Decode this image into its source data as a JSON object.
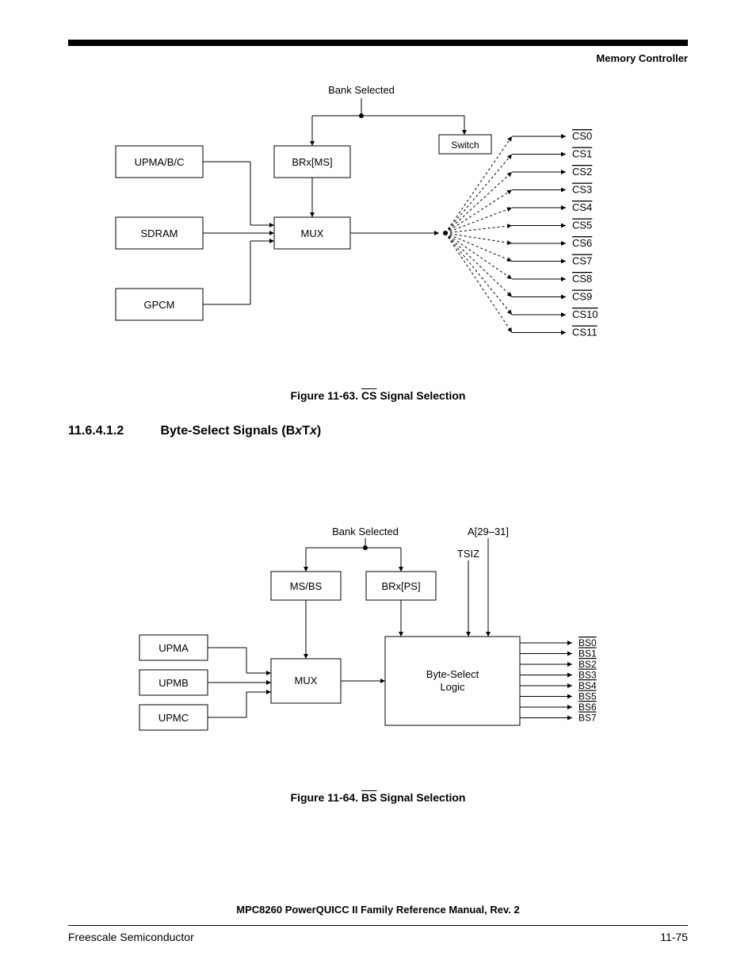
{
  "header_label": "Memory Controller",
  "fig63": {
    "top_label": "Bank Selected",
    "box_upma": "UPMA/B/C",
    "box_sdram": "SDRAM",
    "box_gpcm": "GPCM",
    "box_brx": "BRx[MS]",
    "box_mux": "MUX",
    "switch_label": "Switch",
    "cs_labels": [
      "CS0",
      "CS1",
      "CS2",
      "CS3",
      "CS4",
      "CS5",
      "CS6",
      "CS7",
      "CS8",
      "CS9",
      "CS10",
      "CS11"
    ],
    "caption_prefix": "Figure 11-63. ",
    "caption_signal": "CS",
    "caption_suffix": " Signal Selection"
  },
  "section": {
    "number": "11.6.4.1.2",
    "title_prefix": "Byte-Select Signals (B",
    "title_mid1": "x",
    "title_mid2": "T",
    "title_mid3": "x",
    "title_suffix": ")"
  },
  "fig64": {
    "top_left": "Bank Selected",
    "top_right": "A[29–31]",
    "tsiz": "TSIZ",
    "box_msbs": "MS/BS",
    "box_brx": "BRx[PS]",
    "box_upma": "UPMA",
    "box_upmb": "UPMB",
    "box_upmc": "UPMC",
    "box_mux": "MUX",
    "box_bslogic_l1": "Byte-Select",
    "box_bslogic_l2": "Logic",
    "bs_labels": [
      "BS0",
      "BS1",
      "BS2",
      "BS3",
      "BS4",
      "BS5",
      "BS6",
      "BS7"
    ],
    "caption_prefix": "Figure 11-64. ",
    "caption_signal": "BS",
    "caption_suffix": " Signal Selection"
  },
  "footer": {
    "title": "MPC8260 PowerQUICC II Family Reference Manual, Rev. 2",
    "left": "Freescale Semiconductor",
    "right": "11-75"
  }
}
